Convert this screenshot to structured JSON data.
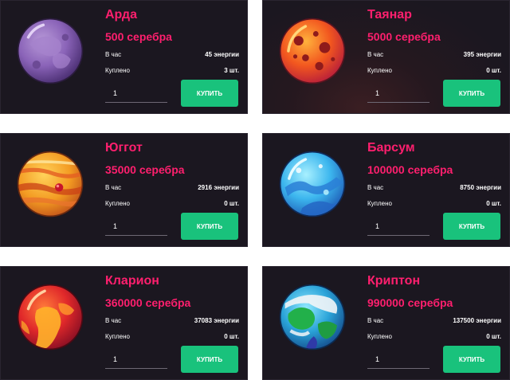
{
  "planets": [
    {
      "name": "Арда",
      "price": "500 серебра",
      "per_hour_label": "В час",
      "per_hour_value": "45 энергии",
      "bought_label": "Куплено",
      "bought_value": "3 шт.",
      "quantity": "1",
      "buy_label": "КУПИТЬ",
      "icon": "purple-planet-icon"
    },
    {
      "name": "Таянар",
      "price": "5000 серебра",
      "per_hour_label": "В час",
      "per_hour_value": "395 энергии",
      "bought_label": "Куплено",
      "bought_value": "0 шт.",
      "quantity": "1",
      "buy_label": "КУПИТЬ",
      "icon": "lava-planet-icon"
    },
    {
      "name": "Юггот",
      "price": "35000 серебра",
      "per_hour_label": "В час",
      "per_hour_value": "2916 энергии",
      "bought_label": "Куплено",
      "bought_value": "0 шт.",
      "quantity": "1",
      "buy_label": "КУПИТЬ",
      "icon": "gas-giant-icon"
    },
    {
      "name": "Барсум",
      "price": "100000 серебра",
      "per_hour_label": "В час",
      "per_hour_value": "8750 энергии",
      "bought_label": "Куплено",
      "bought_value": "0 шт.",
      "quantity": "1",
      "buy_label": "КУПИТЬ",
      "icon": "ice-planet-icon"
    },
    {
      "name": "Кларион",
      "price": "360000 серебра",
      "per_hour_label": "В час",
      "per_hour_value": "37083 энергии",
      "bought_label": "Куплено",
      "bought_value": "0 шт.",
      "quantity": "1",
      "buy_label": "КУПИТЬ",
      "icon": "molten-planet-icon"
    },
    {
      "name": "Криптон",
      "price": "990000 серебра",
      "per_hour_label": "В час",
      "per_hour_value": "137500 энергии",
      "bought_label": "Куплено",
      "bought_value": "0 шт.",
      "quantity": "1",
      "buy_label": "КУПИТЬ",
      "icon": "earth-planet-icon"
    }
  ],
  "colors": {
    "card_bg": "#1b1720",
    "accent": "#ff1f6e",
    "buy_button": "#19c27c",
    "text": "#ffffff"
  }
}
